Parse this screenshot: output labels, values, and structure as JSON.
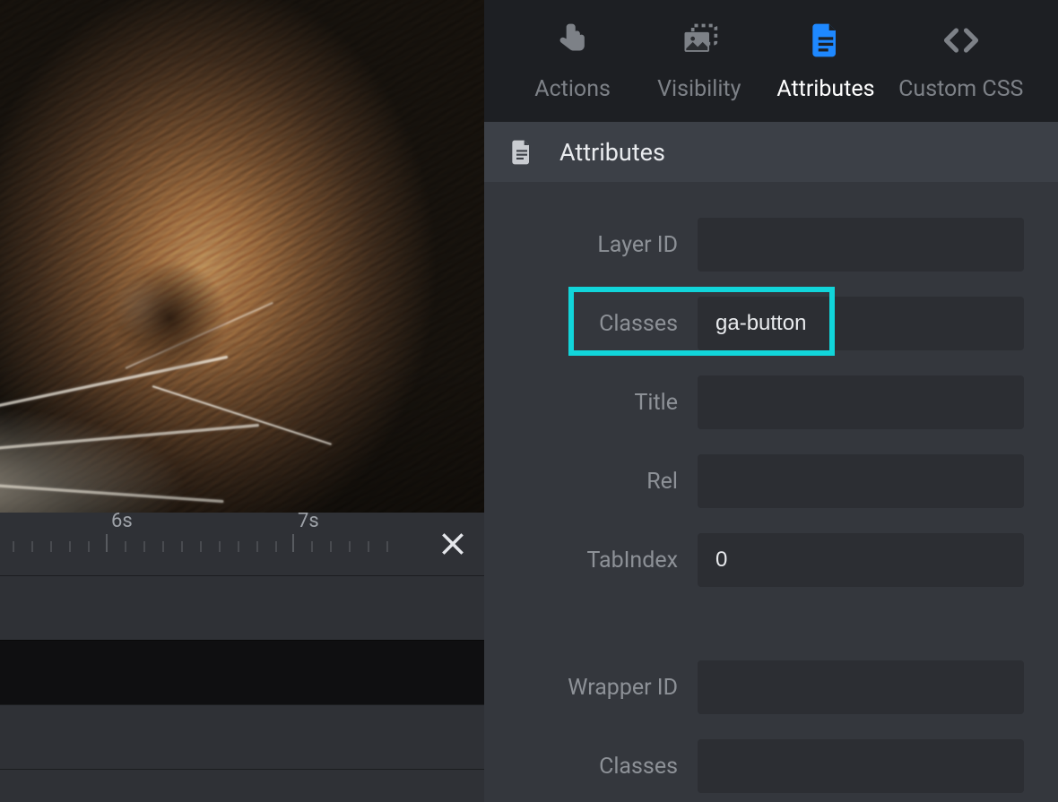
{
  "tabs": {
    "actions": {
      "label": "Actions"
    },
    "visibility": {
      "label": "Visibility"
    },
    "attributes": {
      "label": "Attributes",
      "active": true
    },
    "customcss": {
      "label": "Custom CSS"
    }
  },
  "section": {
    "title": "Attributes"
  },
  "fields": {
    "layerId": {
      "label": "Layer ID",
      "value": ""
    },
    "classes": {
      "label": "Classes",
      "value": "ga-button"
    },
    "title": {
      "label": "Title",
      "value": ""
    },
    "rel": {
      "label": "Rel",
      "value": ""
    },
    "tabIndex": {
      "label": "TabIndex",
      "value": "0"
    },
    "wrapperId": {
      "label": "Wrapper ID",
      "value": ""
    },
    "classes2": {
      "label": "Classes",
      "value": ""
    }
  },
  "timeline": {
    "markers": [
      "6s",
      "7s"
    ]
  },
  "colors": {
    "accent": "#1e88ff",
    "highlight": "#11d5da"
  }
}
